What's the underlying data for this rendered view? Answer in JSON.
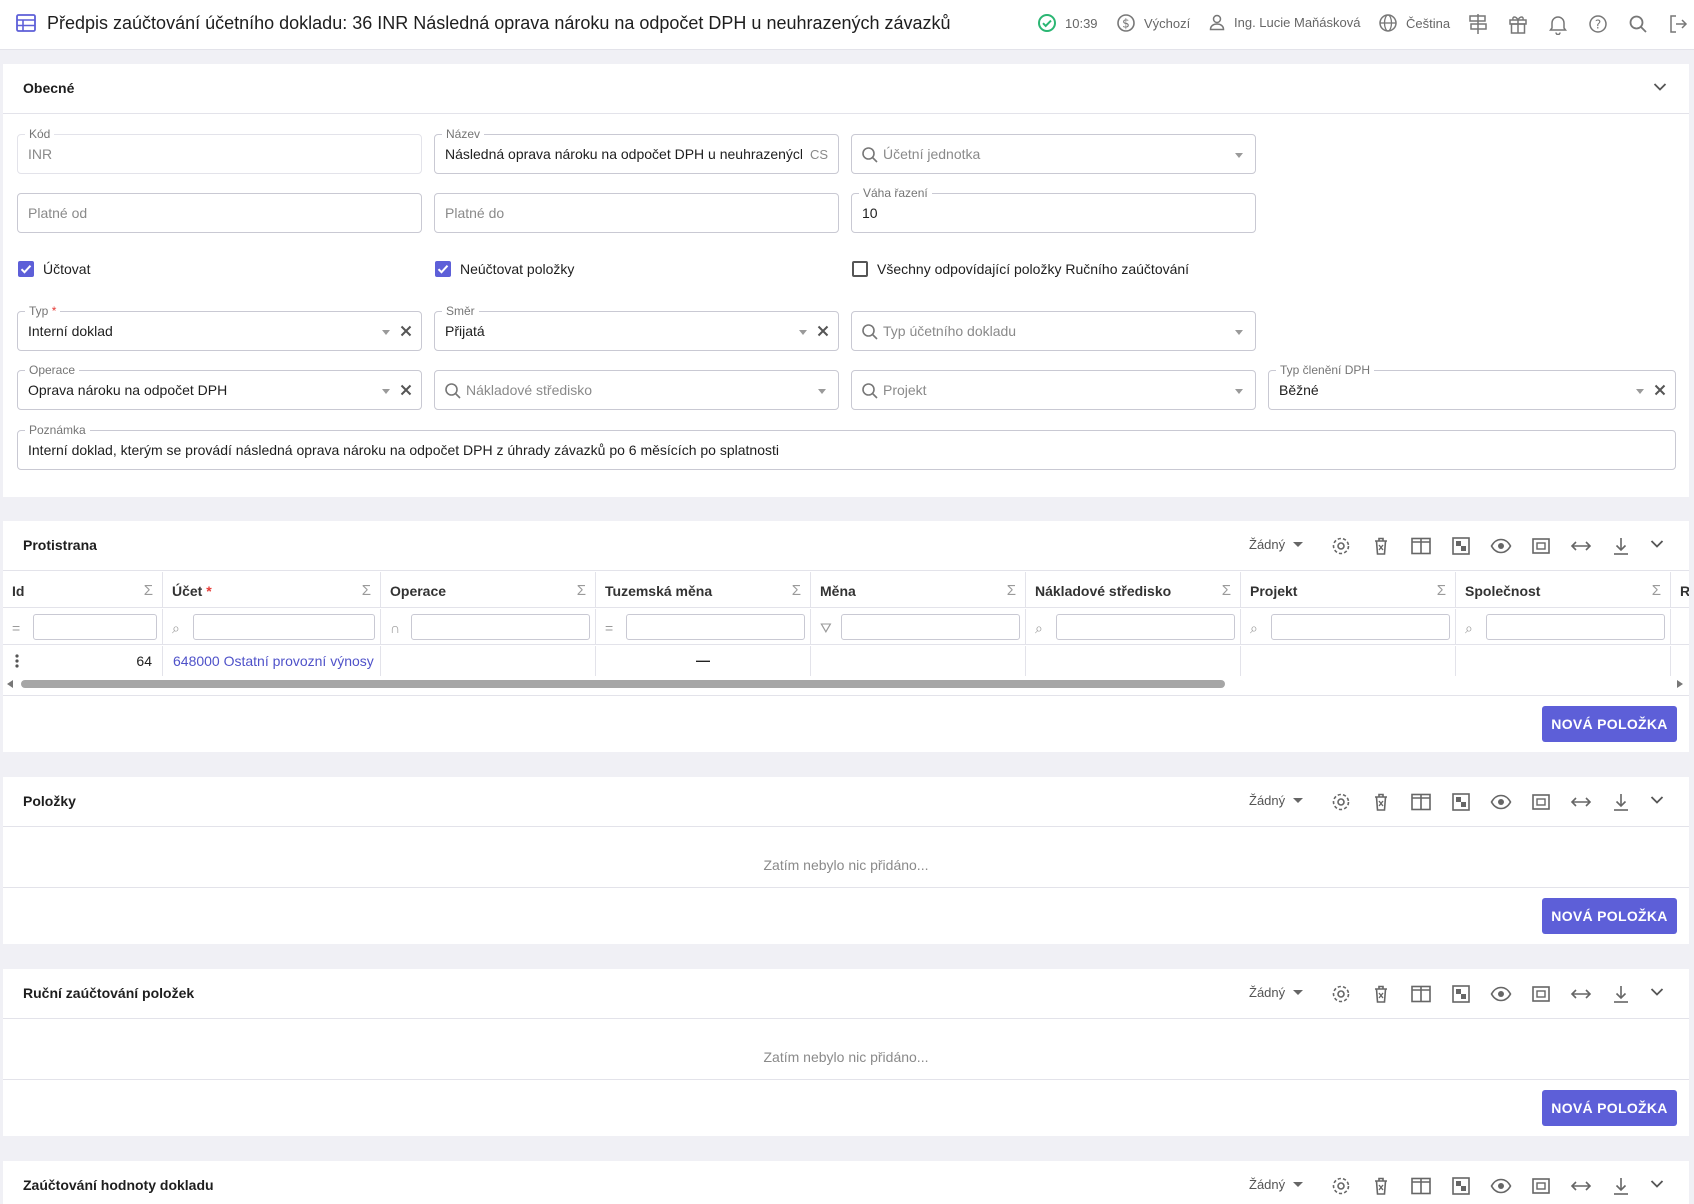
{
  "header": {
    "title": "Předpis zaúčtování účetního dokladu: 36 INR Následná oprava nároku na odpočet DPH u neuhrazených závazků",
    "time": "10:39",
    "currency": "Výchozí",
    "user": "Ing. Lucie Maňásková",
    "language": "Čeština"
  },
  "general": {
    "title": "Obecné",
    "kod_label": "Kód",
    "kod_value": "INR",
    "nazev_label": "Název",
    "nazev_value": "Následná oprava nároku na odpočet DPH u neuhrazených",
    "nazev_suffix": "CS",
    "ucetni_jednotka_placeholder": "Účetní jednotka",
    "platne_od_placeholder": "Platné od",
    "platne_do_placeholder": "Platné do",
    "vaha_label": "Váha řazení",
    "vaha_value": "10",
    "cb_uctovat": "Účtovat",
    "cb_uctovat_checked": true,
    "cb_neuctovat": "Neúčtovat položky",
    "cb_neuctovat_checked": true,
    "cb_vsechny": "Všechny odpovídající položky Ručního zaúčtování",
    "cb_vsechny_checked": false,
    "typ_label": "Typ",
    "typ_value": "Interní doklad",
    "smer_label": "Směr",
    "smer_value": "Přijatá",
    "typ_dokladu_placeholder": "Typ účetního dokladu",
    "operace_label": "Operace",
    "operace_value": "Oprava nároku na odpočet DPH",
    "nakladove_placeholder": "Nákladové středisko",
    "projekt_placeholder": "Projekt",
    "typ_cleneni_label": "Typ členění DPH",
    "typ_cleneni_value": "Běžné",
    "poznamka_label": "Poznámka",
    "poznamka_value": "Interní doklad, kterým se provádí následná oprava nároku na odpočet DPH z úhrady závazků po 6 měsících po splatnosti"
  },
  "toolbar": {
    "none_label": "Žádný"
  },
  "protistrana": {
    "title": "Protistrana",
    "columns": [
      "Id",
      "Účet",
      "Operace",
      "Tuzemská měna",
      "Měna",
      "Nákladové středisko",
      "Projekt",
      "Společnost",
      "R"
    ],
    "filter_icons": [
      "=",
      "⌕",
      "∩",
      "=",
      "⛛",
      "⌕",
      "⌕",
      "⌕"
    ],
    "row": {
      "id": "64",
      "ucet": "648000 Ostatní provozní výnosy",
      "tuzemska_mena": "—"
    },
    "add_button": "NOVÁ POLOŽKA"
  },
  "polozky": {
    "title": "Položky",
    "empty": "Zatím nebylo nic přidáno...",
    "add_button": "NOVÁ POLOŽKA"
  },
  "rucni": {
    "title": "Ruční zaúčtování položek",
    "empty": "Zatím nebylo nic přidáno...",
    "add_button": "NOVÁ POLOŽKA"
  },
  "zauctovani": {
    "title": "Zaúčtování hodnoty dokladu"
  },
  "colors": {
    "accent": "#5d5fd8",
    "link": "#4f52c9",
    "ok": "#2bb673"
  }
}
